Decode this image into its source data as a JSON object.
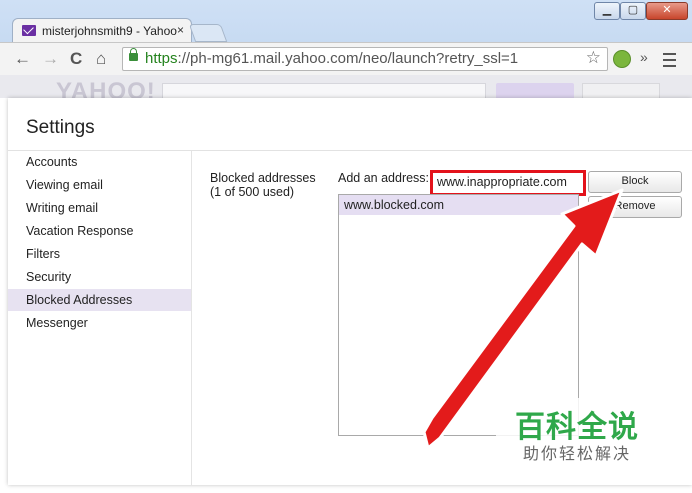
{
  "browser": {
    "tab_title": "misterjohnsmith9 - Yahoo",
    "tab_close": "×",
    "window_buttons": {
      "minimize": "▁",
      "maximize": "▢",
      "close": "✕"
    },
    "nav": {
      "back": "←",
      "forward": "→",
      "reload": "C",
      "home": "⌂"
    },
    "url_scheme": "https",
    "url_rest": "://ph-mg61.mail.yahoo.com/neo/launch?retry_ssl=1",
    "star": "☆",
    "more_ext": "»",
    "icons": [
      "mail-icon",
      "lock-icon",
      "star-icon",
      "extension-icon",
      "menu-icon"
    ]
  },
  "yahoo_header": {
    "logo": "YAHOO!"
  },
  "settings": {
    "title": "Settings",
    "sidebar": [
      {
        "label": "Accounts",
        "active": false
      },
      {
        "label": "Viewing email",
        "active": false
      },
      {
        "label": "Writing email",
        "active": false
      },
      {
        "label": "Vacation Response",
        "active": false
      },
      {
        "label": "Filters",
        "active": false
      },
      {
        "label": "Security",
        "active": false
      },
      {
        "label": "Blocked Addresses",
        "active": true
      },
      {
        "label": "Messenger",
        "active": false
      }
    ],
    "blocked": {
      "section_label": "Blocked addresses",
      "count_label": "(1 of 500 used)",
      "add_label": "Add an address:",
      "input_value": "www.inappropriate.com",
      "block_button": "Block",
      "remove_button": "Remove",
      "list": [
        "www.blocked.com"
      ]
    }
  },
  "watermark": {
    "big": "百科全说",
    "small": "助你轻松解决"
  },
  "colors": {
    "highlight": "#e3121b",
    "active_item": "#e7e2f1",
    "watermark_green": "#2fa84a"
  }
}
